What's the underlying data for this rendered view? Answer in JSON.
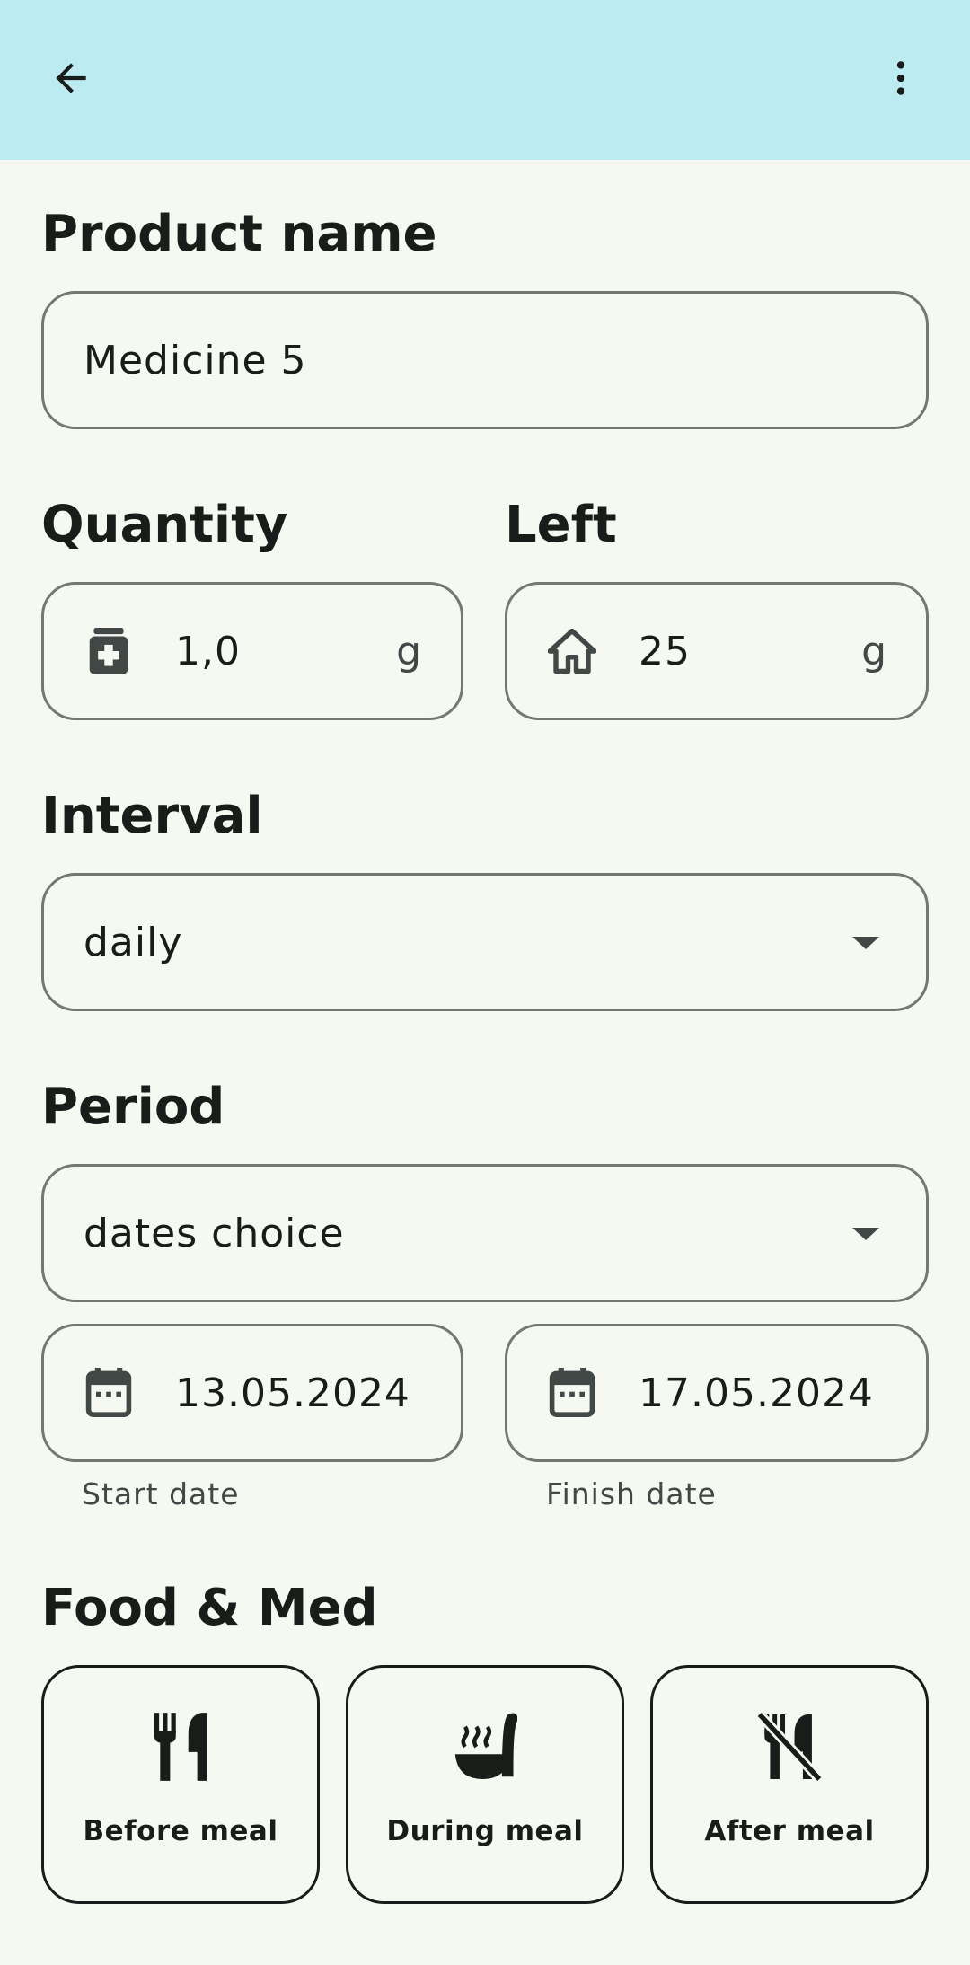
{
  "appbar": {
    "back_icon": "arrow-back-icon",
    "more_icon": "more-vert-icon",
    "background": "#bcebf1"
  },
  "product": {
    "title": "Product name",
    "value": "Medicine 5"
  },
  "quantity": {
    "title": "Quantity",
    "icon": "medication-icon",
    "value": "1,0",
    "unit": "g"
  },
  "left": {
    "title": "Left",
    "icon": "home-icon",
    "value": "25",
    "unit": "g"
  },
  "interval": {
    "title": "Interval",
    "selected": "daily"
  },
  "period": {
    "title": "Period",
    "selected": "dates choice",
    "start": {
      "icon": "calendar-icon",
      "value": "13.05.2024",
      "label": "Start date"
    },
    "finish": {
      "icon": "calendar-icon",
      "value": "17.05.2024",
      "label": "Finish date"
    }
  },
  "food_med": {
    "title": "Food & Med",
    "options": [
      {
        "label": "Before meal",
        "icon": "restaurant-icon"
      },
      {
        "label": "During meal",
        "icon": "soup-ladle-icon"
      },
      {
        "label": "After meal",
        "icon": "no-meals-icon"
      }
    ]
  }
}
